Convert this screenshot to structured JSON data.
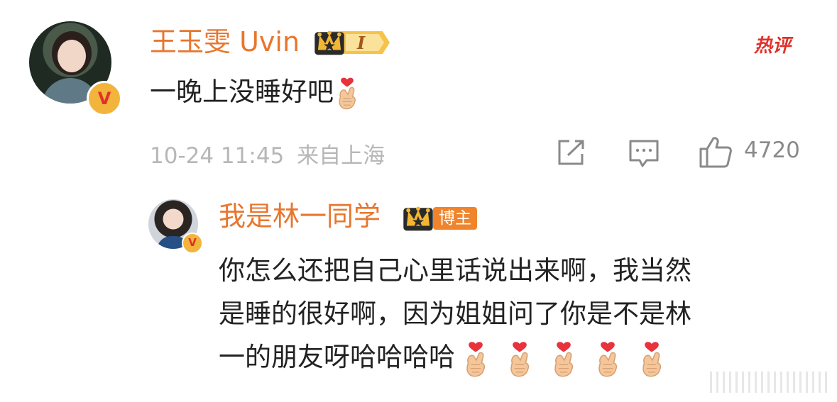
{
  "comment": {
    "author": "王玉雯 Uvin",
    "level_badge": "I",
    "hot_tag": "热评",
    "text": "一晚上没睡好吧",
    "date": "10-24 11:45",
    "location": "来自上海",
    "likes": "4720",
    "verified": "V"
  },
  "reply": {
    "author": "我是林一同学",
    "role_badge": "博主",
    "verified": "V",
    "lines": [
      "你怎么还把自己心里话说出来啊，我当然",
      "是睡的很好啊，因为姐姐问了你是不是林",
      "一的朋友呀哈哈哈哈"
    ]
  },
  "icons": [
    "share-icon",
    "comment-icon",
    "like-icon",
    "crown-icon",
    "finger-heart-emoji"
  ],
  "colors": {
    "name": "#e8762e",
    "hot": "#e0312a",
    "meta": "#b7b7b7",
    "badge_gold": "#f3b43b"
  }
}
